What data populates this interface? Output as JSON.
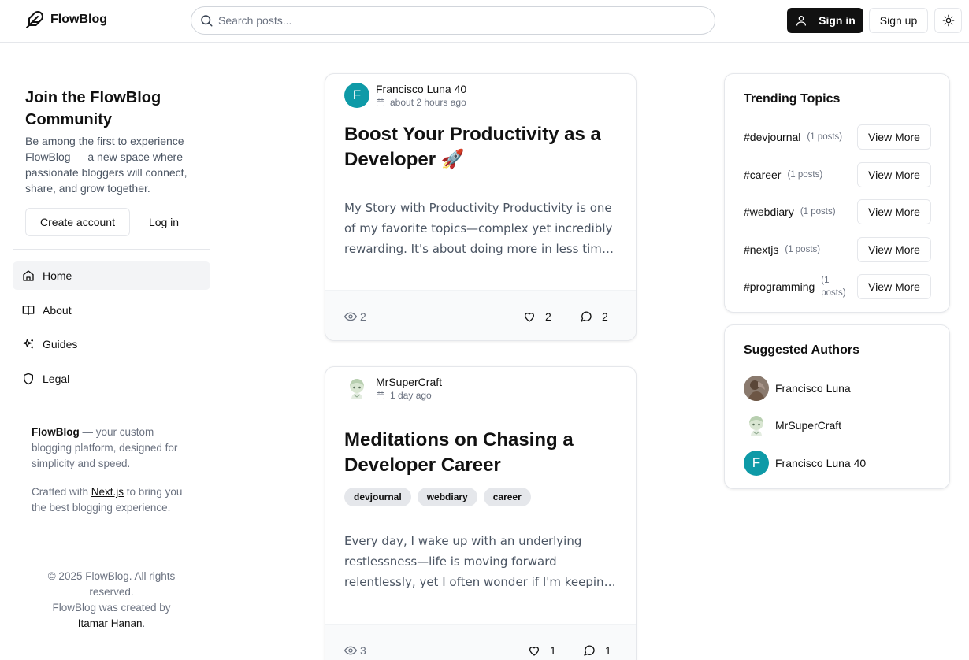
{
  "header": {
    "logo": "FlowBlog",
    "search_placeholder": "Search posts...",
    "sign_in": "Sign in",
    "sign_up": "Sign up"
  },
  "sidebar": {
    "join_title": "Join the FlowBlog Community",
    "join_desc": "Be among the first to experience FlowBlog — a new space where passionate bloggers will connect, share, and grow together.",
    "create_account": "Create account",
    "log_in": "Log in",
    "nav": [
      {
        "label": "Home",
        "icon": "home-icon",
        "active": true
      },
      {
        "label": "About",
        "icon": "book-icon"
      },
      {
        "label": "Guides",
        "icon": "sparkles-icon"
      },
      {
        "label": "Legal",
        "icon": "shield-icon"
      }
    ],
    "about_brand": "FlowBlog",
    "about_1_rest": " — your custom blogging platform, designed for simplicity and speed.",
    "about_2_pre": "Crafted with ",
    "about_2_link": "Next.js",
    "about_2_post": " to bring you the best blogging experience.",
    "footer_copy": "© 2025 FlowBlog. All rights reserved.",
    "footer_created": "FlowBlog was created by",
    "footer_author": "Itamar Hanan",
    "footer_period": "."
  },
  "posts": [
    {
      "author": "Francisco Luna 40",
      "avatar_letter": "F",
      "time": "about 2 hours ago",
      "title": "Boost Your Productivity as a Developer 🚀",
      "excerpt": "My Story with Productivity Productivity is one of my favorite topics—complex yet incredibly rewarding. It's about doing more in less time and finding the balance.",
      "tags": [],
      "views": "2",
      "likes": "2",
      "comments": "2"
    },
    {
      "author": "MrSuperCraft",
      "time": "1 day ago",
      "title": "Meditations on Chasing a Developer Career",
      "excerpt": "Every day, I wake up with an underlying restlessness—life is moving forward relentlessly, yet I often wonder if I'm keeping up with what matters most to me.",
      "tags": [
        "devjournal",
        "webdiary",
        "career"
      ],
      "views": "3",
      "likes": "1",
      "comments": "1"
    }
  ],
  "trending": {
    "title": "Trending Topics",
    "view_more": "View More",
    "topics": [
      {
        "name": "#devjournal",
        "count": "(1 posts)"
      },
      {
        "name": "#career",
        "count": "(1 posts)"
      },
      {
        "name": "#webdiary",
        "count": "(1 posts)"
      },
      {
        "name": "#nextjs",
        "count": "(1 posts)"
      },
      {
        "name": "#programming",
        "count_1": "(1",
        "count_2": "posts)"
      }
    ]
  },
  "suggested": {
    "title": "Suggested Authors",
    "authors": [
      {
        "name": "Francisco Luna",
        "avatar": "photo"
      },
      {
        "name": "MrSuperCraft",
        "avatar": "anime"
      },
      {
        "name": "Francisco Luna 40",
        "avatar_letter": "F"
      }
    ]
  },
  "colors": {
    "accent_dark": "#111111",
    "avatar_teal": "#0e9aa7",
    "muted_text": "#6b7280",
    "border": "#e5e7eb"
  }
}
